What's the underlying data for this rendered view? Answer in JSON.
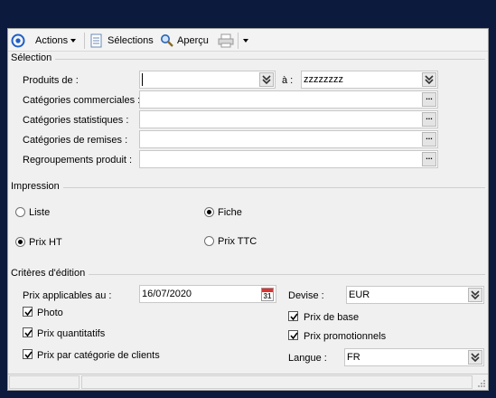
{
  "toolbar": {
    "actions_label": "Actions",
    "selections_label": "Sélections",
    "preview_label": "Aperçu"
  },
  "selection": {
    "title": "Sélection",
    "products_label": "Produits de :",
    "products_from_value": "",
    "to_label": "à :",
    "products_to_value": "zzzzzzzz",
    "commercial_categories_label": "Catégories commerciales :",
    "statistical_categories_label": "Catégories statistiques :",
    "discount_categories_label": "Catégories de remises :",
    "product_groupings_label": "Regroupements produit :",
    "dots": "..."
  },
  "impression": {
    "title": "Impression",
    "liste_label": "Liste",
    "fiche_label": "Fiche",
    "prix_ht_label": "Prix HT",
    "prix_ttc_label": "Prix TTC",
    "selected_layout": "Fiche",
    "selected_price": "Prix HT"
  },
  "criteria": {
    "title": "Critères d'édition",
    "prices_applicable_label": "Prix applicables au :",
    "date_value": "16/07/2020",
    "calendar_day": "31",
    "currency_label": "Devise :",
    "currency_value": "EUR",
    "photo_label": "Photo",
    "photo_checked": true,
    "quantity_prices_label": "Prix quantitatifs",
    "quantity_prices_checked": true,
    "client_category_prices_label": "Prix par catégorie de clients",
    "client_category_prices_checked": true,
    "base_price_label": "Prix de base",
    "base_price_checked": true,
    "promo_prices_label": "Prix promotionnels",
    "promo_prices_checked": true,
    "language_label": "Langue :",
    "language_value": "FR"
  },
  "colors": {
    "background": "#0b1a3d",
    "panel": "#f0f0f0",
    "accent_icon": "#1e5fc8"
  }
}
